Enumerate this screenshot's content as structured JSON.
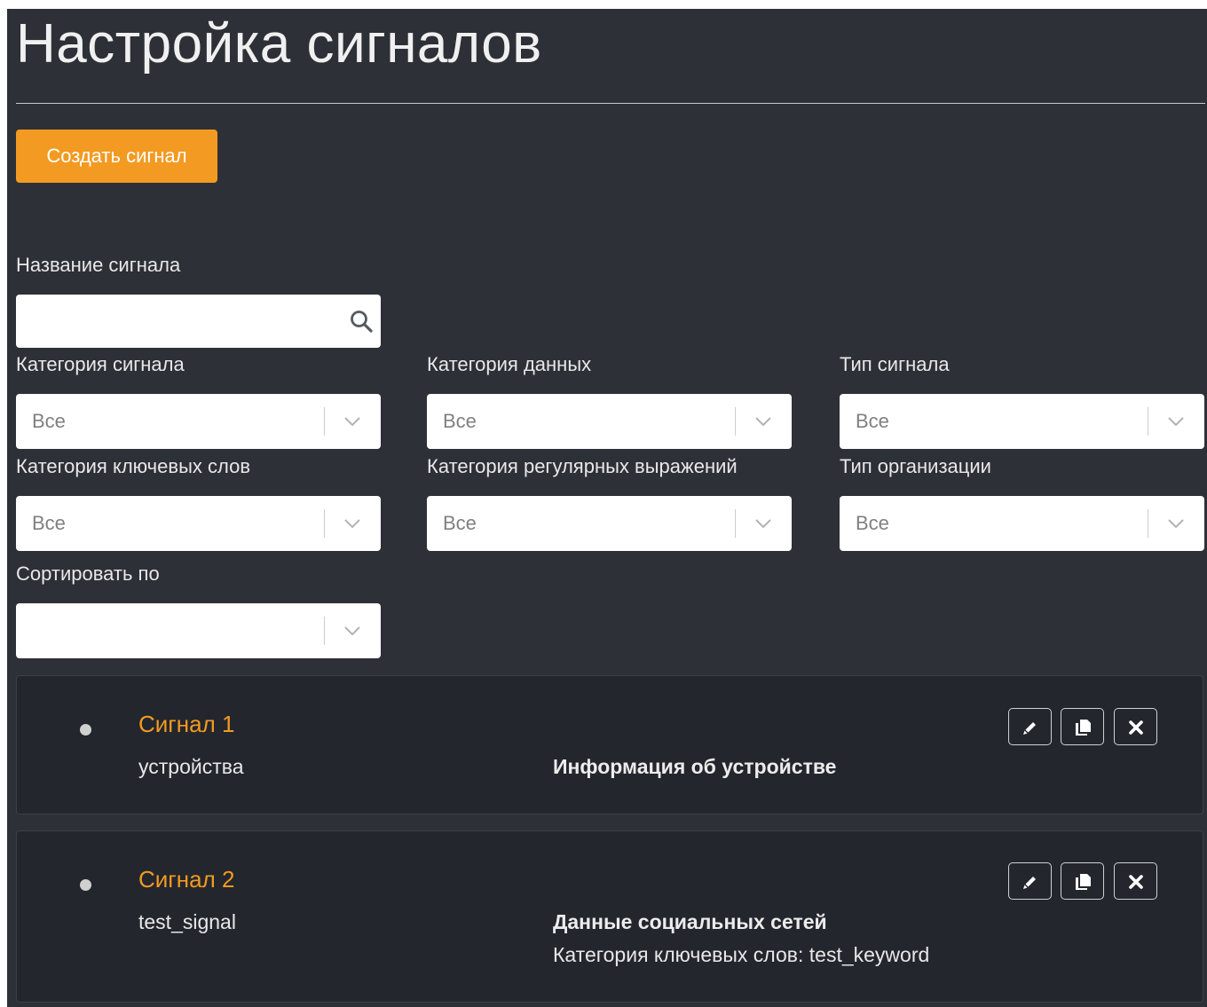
{
  "page": {
    "title": "Настройка сигналов",
    "create_button_label": "Создать сигнал"
  },
  "filters": {
    "signal_name": {
      "label": "Название сигнала",
      "value": "",
      "placeholder": ""
    },
    "signal_category": {
      "label": "Категория сигнала",
      "value": "Все"
    },
    "data_category": {
      "label": "Категория данных",
      "value": "Все"
    },
    "signal_type": {
      "label": "Тип сигнала",
      "value": "Все"
    },
    "keyword_category": {
      "label": "Категория ключевых слов",
      "value": "Все"
    },
    "regex_category": {
      "label": "Категория регулярных выражений",
      "value": "Все"
    },
    "org_type": {
      "label": "Тип организации",
      "value": "Все"
    },
    "sort_by": {
      "label": "Сортировать по",
      "value": ""
    }
  },
  "signals": [
    {
      "name": "Сигнал 1",
      "subtitle": "устройства",
      "data_category": "Информация об устройстве",
      "extra": ""
    },
    {
      "name": "Сигнал 2",
      "subtitle": "test_signal",
      "data_category": "Данные социальных сетей",
      "extra": "Категория ключевых слов: test_keyword"
    }
  ],
  "icons": {
    "search": "search-icon",
    "dropdown": "chevron-down-icon",
    "edit": "pencil-icon",
    "copy": "copy-icon",
    "delete": "close-icon"
  },
  "colors": {
    "background": "#2d3037",
    "card_background": "#23262d",
    "accent": "#f39a22",
    "text": "#e8e8e8",
    "input_background": "#ffffff",
    "select_placeholder": "#808080"
  }
}
